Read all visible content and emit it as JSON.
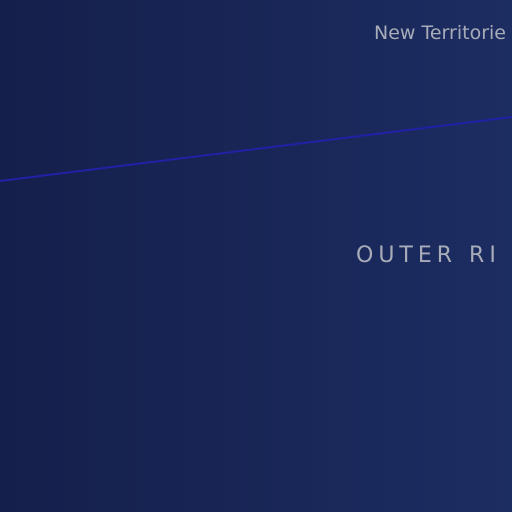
{
  "map": {
    "background_colors": [
      "#151f4b",
      "#1c2d62"
    ],
    "line_color": "#2121a8",
    "labels": {
      "territory": "New Territorie",
      "region": "OUTER RI"
    }
  }
}
